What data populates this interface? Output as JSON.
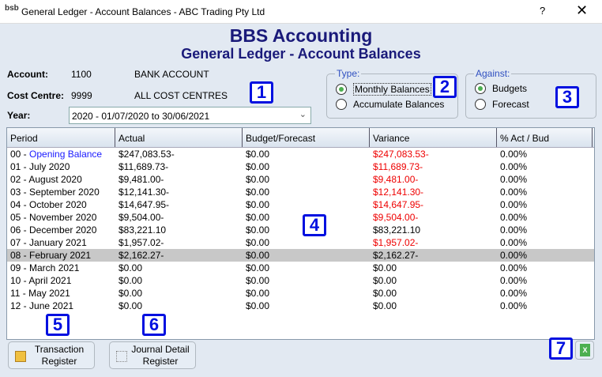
{
  "window": {
    "title": "General Ledger - Account Balances - ABC Trading Pty Ltd",
    "logo": "bsb",
    "help": "?",
    "close": "✕"
  },
  "header": {
    "company": "BBS Accounting",
    "title": "General Ledger - Account Balances"
  },
  "account": {
    "label": "Account:",
    "code": "1100",
    "name": "BANK ACCOUNT"
  },
  "cost_centre": {
    "label": "Cost Centre:",
    "code": "9999",
    "name": "ALL COST CENTRES"
  },
  "year": {
    "label": "Year:",
    "value": "2020 - 01/07/2020 to 30/06/2021"
  },
  "type": {
    "legend": "Type:",
    "options": [
      "Monthly Balances",
      "Accumulate Balances"
    ],
    "selected": "Monthly Balances"
  },
  "against": {
    "legend": "Against:",
    "options": [
      "Budgets",
      "Forecast"
    ],
    "selected": "Budgets"
  },
  "grid": {
    "columns": [
      "Period",
      "Actual",
      "Budget/Forecast",
      "Variance",
      "% Act / Bud"
    ],
    "rows": [
      {
        "num": "00 - ",
        "period": "Opening Balance",
        "actual": "$247,083.53-",
        "budget": "$0.00",
        "variance": "$247,083.53-",
        "pct": "0.00%",
        "neg": true
      },
      {
        "num": "01 - ",
        "period": "July 2020",
        "actual": "$11,689.73-",
        "budget": "$0.00",
        "variance": "$11,689.73-",
        "pct": "0.00%",
        "neg": true
      },
      {
        "num": "02 - ",
        "period": "August 2020",
        "actual": "$9,481.00-",
        "budget": "$0.00",
        "variance": "$9,481.00-",
        "pct": "0.00%",
        "neg": true
      },
      {
        "num": "03 - ",
        "period": "September 2020",
        "actual": "$12,141.30-",
        "budget": "$0.00",
        "variance": "$12,141.30-",
        "pct": "0.00%",
        "neg": true
      },
      {
        "num": "04 - ",
        "period": "October 2020",
        "actual": "$14,647.95-",
        "budget": "$0.00",
        "variance": "$14,647.95-",
        "pct": "0.00%",
        "neg": true
      },
      {
        "num": "05 - ",
        "period": "November 2020",
        "actual": "$9,504.00-",
        "budget": "$0.00",
        "variance": "$9,504.00-",
        "pct": "0.00%",
        "neg": true
      },
      {
        "num": "06 - ",
        "period": "December 2020",
        "actual": "$83,221.10",
        "budget": "$0.00",
        "variance": "$83,221.10",
        "pct": "0.00%",
        "neg": false
      },
      {
        "num": "07 - ",
        "period": "January 2021",
        "actual": "$1,957.02-",
        "budget": "$0.00",
        "variance": "$1,957.02-",
        "pct": "0.00%",
        "neg": true
      },
      {
        "num": "08 - ",
        "period": "February 2021",
        "actual": "$2,162.27-",
        "budget": "$0.00",
        "variance": "$2,162.27-",
        "pct": "0.00%",
        "neg": false,
        "selected": true
      },
      {
        "num": "09 - ",
        "period": "March 2021",
        "actual": "$0.00",
        "budget": "$0.00",
        "variance": "$0.00",
        "pct": "0.00%",
        "neg": false
      },
      {
        "num": "10 - ",
        "period": "April 2021",
        "actual": "$0.00",
        "budget": "$0.00",
        "variance": "$0.00",
        "pct": "0.00%",
        "neg": false
      },
      {
        "num": "11 - ",
        "period": "May 2021",
        "actual": "$0.00",
        "budget": "$0.00",
        "variance": "$0.00",
        "pct": "0.00%",
        "neg": false
      },
      {
        "num": "12 - ",
        "period": "June 2021",
        "actual": "$0.00",
        "budget": "$0.00",
        "variance": "$0.00",
        "pct": "0.00%",
        "neg": false
      }
    ]
  },
  "buttons": {
    "transaction_register": [
      "Transaction",
      "Register"
    ],
    "journal_detail_register": [
      "Journal Detail",
      "Register"
    ],
    "excel": "X"
  },
  "badges": [
    "1",
    "2",
    "3",
    "4",
    "5",
    "6",
    "7"
  ],
  "colors": {
    "title": "#1a1a7a",
    "negative": "#e00000",
    "badge": "#0010e0",
    "link": "#1a1aff"
  }
}
